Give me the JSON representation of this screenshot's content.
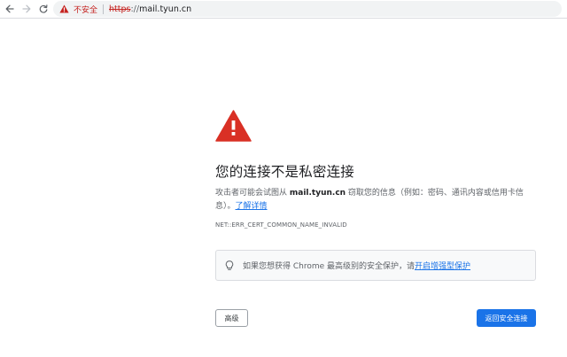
{
  "browser": {
    "security_label": "不安全",
    "url": {
      "scheme": "https",
      "separator": "://",
      "host": "mail.tyun.cn"
    }
  },
  "page": {
    "heading": "您的连接不是私密连接",
    "explanation": {
      "before": "攻击者可能会试图从 ",
      "domain": "mail.tyun.cn",
      "after": " 窃取您的信息（例如：密码、通讯内容或信用卡信息）。",
      "learn_more": "了解详情"
    },
    "error_code": "NET::ERR_CERT_COMMON_NAME_INVALID",
    "promo": {
      "text": "如果您想获得 Chrome 最高级别的安全保护，请",
      "link": "开启增强型保护"
    },
    "buttons": {
      "advanced": "高级",
      "back_to_safety": "返回安全连接"
    }
  },
  "colors": {
    "warning_red": "#d93025",
    "link_blue": "#1a73e8",
    "primary_button": "#1a73e8"
  },
  "icons": {
    "back": "arrow-left-icon",
    "forward": "arrow-right-icon",
    "reload": "reload-icon",
    "security": "warning-triangle-icon",
    "main": "warning-triangle-icon",
    "promo": "lightbulb-icon"
  }
}
